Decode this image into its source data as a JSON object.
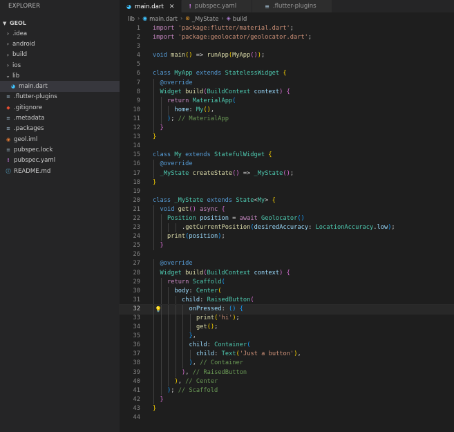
{
  "sidebar": {
    "header": "EXPLORER",
    "section": "GEOL",
    "items": [
      {
        "label": ".idea",
        "kind": "folder"
      },
      {
        "label": "android",
        "kind": "folder"
      },
      {
        "label": "build",
        "kind": "folder"
      },
      {
        "label": "ios",
        "kind": "folder"
      },
      {
        "label": "lib",
        "kind": "folder-open"
      },
      {
        "label": "main.dart",
        "kind": "dart-file"
      },
      {
        "label": ".flutter-plugins",
        "kind": "text-file"
      },
      {
        "label": ".gitignore",
        "kind": "git-file"
      },
      {
        "label": ".metadata",
        "kind": "text-file"
      },
      {
        "label": ".packages",
        "kind": "text-file"
      },
      {
        "label": "geol.iml",
        "kind": "rss-file"
      },
      {
        "label": "pubspec.lock",
        "kind": "text-file"
      },
      {
        "label": "pubspec.yaml",
        "kind": "yaml-file"
      },
      {
        "label": "README.md",
        "kind": "info-file"
      }
    ]
  },
  "tabs": [
    {
      "label": "main.dart",
      "icon": "dart-icon",
      "active": true
    },
    {
      "label": "pubspec.yaml",
      "icon": "yaml-icon",
      "active": false
    },
    {
      "label": ".flutter-plugins",
      "icon": "file-lines-icon",
      "active": false
    }
  ],
  "breadcrumb": {
    "items": [
      "lib",
      "main.dart",
      "_MyState",
      "build"
    ]
  },
  "editor": {
    "current_line": 32,
    "lines": [
      {
        "n": "1",
        "indent": 0,
        "code": [
          [
            "ctl",
            "import "
          ],
          [
            "str",
            "'package:flutter/material.dart'"
          ],
          [
            "pun",
            ";"
          ]
        ]
      },
      {
        "n": "2",
        "indent": 0,
        "code": [
          [
            "ctl",
            "import "
          ],
          [
            "str",
            "'package:geolocator/geolocator.dart'"
          ],
          [
            "pun",
            ";"
          ]
        ]
      },
      {
        "n": "3",
        "indent": 0,
        "code": []
      },
      {
        "n": "4",
        "indent": 0,
        "code": [
          [
            "kw",
            "void "
          ],
          [
            "fn",
            "main"
          ],
          [
            "brk1",
            "()"
          ],
          [
            "pun",
            " => "
          ],
          [
            "fn",
            "runApp"
          ],
          [
            "brk1",
            "("
          ],
          [
            "fn",
            "MyApp"
          ],
          [
            "brk2",
            "()"
          ],
          [
            "brk1",
            ")"
          ],
          [
            "pun",
            ";"
          ]
        ]
      },
      {
        "n": "5",
        "indent": 0,
        "code": []
      },
      {
        "n": "6",
        "indent": 0,
        "code": [
          [
            "kw",
            "class "
          ],
          [
            "cls",
            "MyApp "
          ],
          [
            "kw",
            "extends "
          ],
          [
            "cls",
            "StatelessWidget "
          ],
          [
            "brk1",
            "{"
          ]
        ]
      },
      {
        "n": "7",
        "indent": 1,
        "code": [
          [
            "kw",
            "@override"
          ]
        ]
      },
      {
        "n": "8",
        "indent": 1,
        "code": [
          [
            "cls",
            "Widget "
          ],
          [
            "fn",
            "build"
          ],
          [
            "brk2",
            "("
          ],
          [
            "cls",
            "BuildContext "
          ],
          [
            "prm",
            "context"
          ],
          [
            "brk2",
            ")"
          ],
          [
            "pun",
            " "
          ],
          [
            "brk2",
            "{"
          ]
        ]
      },
      {
        "n": "9",
        "indent": 2,
        "code": [
          [
            "ctl",
            "return "
          ],
          [
            "cls",
            "MaterialApp"
          ],
          [
            "brk3",
            "("
          ]
        ]
      },
      {
        "n": "10",
        "indent": 3,
        "code": [
          [
            "prm",
            "home"
          ],
          [
            "pun",
            ": "
          ],
          [
            "cls",
            "My"
          ],
          [
            "brk1",
            "()"
          ],
          [
            "pun",
            ","
          ]
        ]
      },
      {
        "n": "11",
        "indent": 2,
        "code": [
          [
            "brk3",
            ")"
          ],
          [
            "pun",
            "; "
          ],
          [
            "cmt",
            "// MaterialApp"
          ]
        ]
      },
      {
        "n": "12",
        "indent": 1,
        "code": [
          [
            "brk2",
            "}"
          ]
        ]
      },
      {
        "n": "13",
        "indent": 0,
        "code": [
          [
            "brk1",
            "}"
          ]
        ]
      },
      {
        "n": "14",
        "indent": 0,
        "code": []
      },
      {
        "n": "15",
        "indent": 0,
        "code": [
          [
            "kw",
            "class "
          ],
          [
            "cls",
            "My "
          ],
          [
            "kw",
            "extends "
          ],
          [
            "cls",
            "StatefulWidget "
          ],
          [
            "brk1",
            "{"
          ]
        ]
      },
      {
        "n": "16",
        "indent": 1,
        "code": [
          [
            "kw",
            "@override"
          ]
        ]
      },
      {
        "n": "17",
        "indent": 1,
        "code": [
          [
            "cls",
            "_MyState "
          ],
          [
            "fn",
            "createState"
          ],
          [
            "brk2",
            "()"
          ],
          [
            "pun",
            " => "
          ],
          [
            "cls",
            "_MyState"
          ],
          [
            "brk2",
            "()"
          ],
          [
            "pun",
            ";"
          ]
        ]
      },
      {
        "n": "18",
        "indent": 0,
        "code": [
          [
            "brk1",
            "}"
          ]
        ]
      },
      {
        "n": "19",
        "indent": 0,
        "code": []
      },
      {
        "n": "20",
        "indent": 0,
        "code": [
          [
            "kw",
            "class "
          ],
          [
            "cls",
            "_MyState "
          ],
          [
            "kw",
            "extends "
          ],
          [
            "cls",
            "State"
          ],
          [
            "pun",
            "<"
          ],
          [
            "cls",
            "My"
          ],
          [
            "pun",
            "> "
          ],
          [
            "brk1",
            "{"
          ]
        ]
      },
      {
        "n": "21",
        "indent": 1,
        "code": [
          [
            "kw",
            "void "
          ],
          [
            "fn",
            "get"
          ],
          [
            "brk2",
            "()"
          ],
          [
            "pun",
            " "
          ],
          [
            "ctl",
            "async "
          ],
          [
            "brk2",
            "{"
          ]
        ]
      },
      {
        "n": "22",
        "indent": 2,
        "code": [
          [
            "cls",
            "Position "
          ],
          [
            "prm",
            "position"
          ],
          [
            "pun",
            " = "
          ],
          [
            "ctl",
            "await "
          ],
          [
            "cls",
            "Geolocator"
          ],
          [
            "brk3",
            "()"
          ]
        ]
      },
      {
        "n": "23",
        "indent": 4,
        "code": [
          [
            "pun",
            "."
          ],
          [
            "fn",
            "getCurrentPosition"
          ],
          [
            "brk3",
            "("
          ],
          [
            "prm",
            "desiredAccuracy"
          ],
          [
            "pun",
            ": "
          ],
          [
            "cls",
            "LocationAccuracy"
          ],
          [
            "pun",
            "."
          ],
          [
            "prm",
            "low"
          ],
          [
            "brk3",
            ")"
          ],
          [
            "pun",
            ";"
          ]
        ]
      },
      {
        "n": "24",
        "indent": 2,
        "code": [
          [
            "fn",
            "print"
          ],
          [
            "brk3",
            "("
          ],
          [
            "prm",
            "position"
          ],
          [
            "brk3",
            ")"
          ],
          [
            "pun",
            ";"
          ]
        ]
      },
      {
        "n": "25",
        "indent": 1,
        "code": [
          [
            "brk2",
            "}"
          ]
        ]
      },
      {
        "n": "26",
        "indent": 0,
        "code": []
      },
      {
        "n": "27",
        "indent": 1,
        "code": [
          [
            "kw",
            "@override"
          ]
        ]
      },
      {
        "n": "28",
        "indent": 1,
        "code": [
          [
            "cls",
            "Widget "
          ],
          [
            "fn",
            "build"
          ],
          [
            "brk2",
            "("
          ],
          [
            "cls",
            "BuildContext "
          ],
          [
            "prm",
            "context"
          ],
          [
            "brk2",
            ")"
          ],
          [
            "pun",
            " "
          ],
          [
            "brk2",
            "{"
          ]
        ]
      },
      {
        "n": "29",
        "indent": 2,
        "code": [
          [
            "ctl",
            "return "
          ],
          [
            "cls",
            "Scaffold"
          ],
          [
            "brk3",
            "("
          ]
        ]
      },
      {
        "n": "30",
        "indent": 3,
        "code": [
          [
            "prm",
            "body"
          ],
          [
            "pun",
            ": "
          ],
          [
            "cls",
            "Center"
          ],
          [
            "brk1",
            "("
          ]
        ]
      },
      {
        "n": "31",
        "indent": 4,
        "code": [
          [
            "prm",
            "child"
          ],
          [
            "pun",
            ": "
          ],
          [
            "cls",
            "RaisedButton"
          ],
          [
            "brk2",
            "("
          ]
        ]
      },
      {
        "n": "32",
        "indent": 5,
        "code": [
          [
            "prm",
            "onPressed"
          ],
          [
            "pun",
            ": "
          ],
          [
            "brk3",
            "()"
          ],
          [
            "pun",
            " "
          ],
          [
            "brk3",
            "{"
          ]
        ]
      },
      {
        "n": "33",
        "indent": 6,
        "code": [
          [
            "fn",
            "print"
          ],
          [
            "brk1",
            "("
          ],
          [
            "str",
            "'hi'"
          ],
          [
            "brk1",
            ")"
          ],
          [
            "pun",
            ";"
          ]
        ]
      },
      {
        "n": "34",
        "indent": 6,
        "code": [
          [
            "fn",
            "get"
          ],
          [
            "brk1",
            "()"
          ],
          [
            "pun",
            ";"
          ]
        ]
      },
      {
        "n": "35",
        "indent": 5,
        "code": [
          [
            "brk3",
            "}"
          ],
          [
            "pun",
            ","
          ]
        ]
      },
      {
        "n": "36",
        "indent": 5,
        "code": [
          [
            "prm",
            "child"
          ],
          [
            "pun",
            ": "
          ],
          [
            "cls",
            "Container"
          ],
          [
            "brk3",
            "("
          ]
        ]
      },
      {
        "n": "37",
        "indent": 6,
        "code": [
          [
            "prm",
            "child"
          ],
          [
            "pun",
            ": "
          ],
          [
            "cls",
            "Text"
          ],
          [
            "brk1",
            "("
          ],
          [
            "str",
            "'Just a button'"
          ],
          [
            "brk1",
            ")"
          ],
          [
            "pun",
            ","
          ]
        ]
      },
      {
        "n": "38",
        "indent": 5,
        "code": [
          [
            "brk3",
            ")"
          ],
          [
            "pun",
            ", "
          ],
          [
            "cmt",
            "// Container"
          ]
        ]
      },
      {
        "n": "39",
        "indent": 4,
        "code": [
          [
            "brk2",
            ")"
          ],
          [
            "pun",
            ", "
          ],
          [
            "cmt",
            "// RaisedButton"
          ]
        ]
      },
      {
        "n": "40",
        "indent": 3,
        "code": [
          [
            "brk1",
            ")"
          ],
          [
            "pun",
            ", "
          ],
          [
            "cmt",
            "// Center"
          ]
        ]
      },
      {
        "n": "41",
        "indent": 2,
        "code": [
          [
            "brk3",
            ")"
          ],
          [
            "pun",
            "; "
          ],
          [
            "cmt",
            "// Scaffold"
          ]
        ]
      },
      {
        "n": "42",
        "indent": 1,
        "code": [
          [
            "brk2",
            "}"
          ]
        ]
      },
      {
        "n": "43",
        "indent": 0,
        "code": [
          [
            "brk1",
            "}"
          ]
        ]
      },
      {
        "n": "44",
        "indent": 0,
        "code": []
      }
    ]
  }
}
